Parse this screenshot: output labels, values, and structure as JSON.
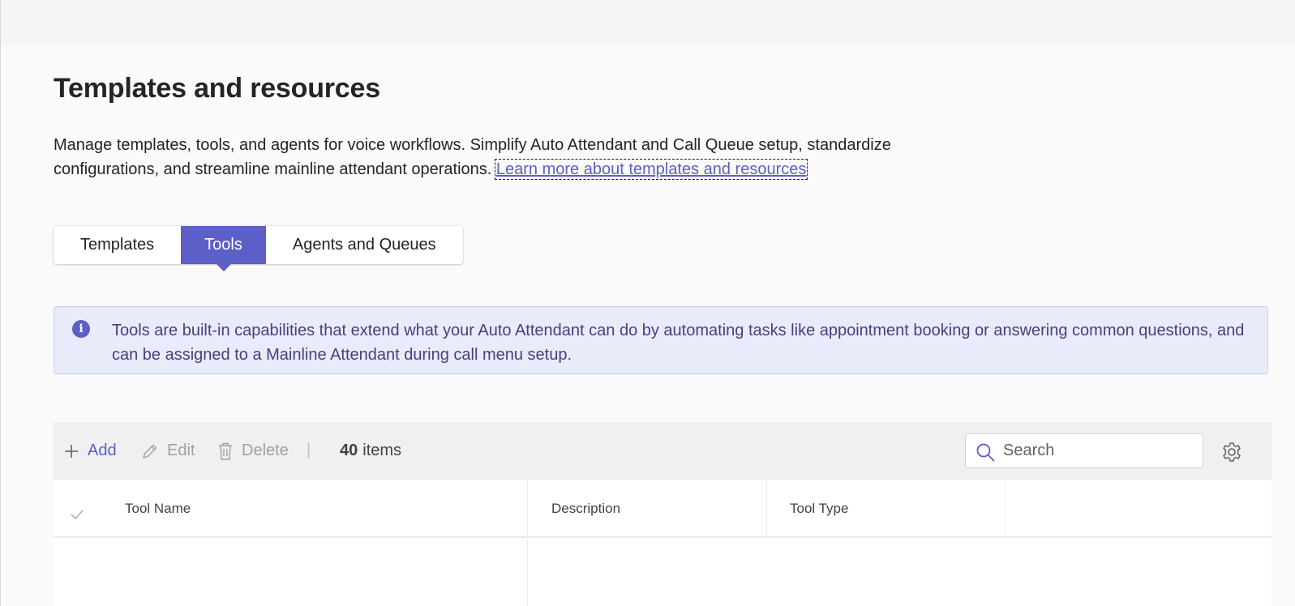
{
  "page": {
    "title": "Templates and resources",
    "description": "Manage templates, tools, and agents for voice workflows. Simplify Auto Attendant and Call Queue setup, standardize configurations, and streamline mainline attendant operations.",
    "learn_more_link": "Learn more about templates and resources"
  },
  "tabs": [
    {
      "label": "Templates",
      "active": false
    },
    {
      "label": "Tools",
      "active": true
    },
    {
      "label": "Agents and Queues",
      "active": false
    }
  ],
  "info": {
    "icon": "info-icon",
    "text": "Tools are built-in capabilities that extend what your Auto Attendant can do by automating tasks like appointment booking or answering common questions, and can be assigned to a Mainline Attendant during call menu setup."
  },
  "toolbar": {
    "add_label": "Add",
    "edit_label": "Edit",
    "delete_label": "Delete",
    "separator": "|",
    "item_count": "40",
    "items_label": "items",
    "search_placeholder": "Search"
  },
  "table": {
    "columns": [
      "Tool Name",
      "Description",
      "Tool Type"
    ]
  },
  "colors": {
    "accent": "#5b5fc7",
    "info_bg": "#e8ebfa",
    "info_text": "#424280",
    "disabled": "#a0a0a0"
  }
}
